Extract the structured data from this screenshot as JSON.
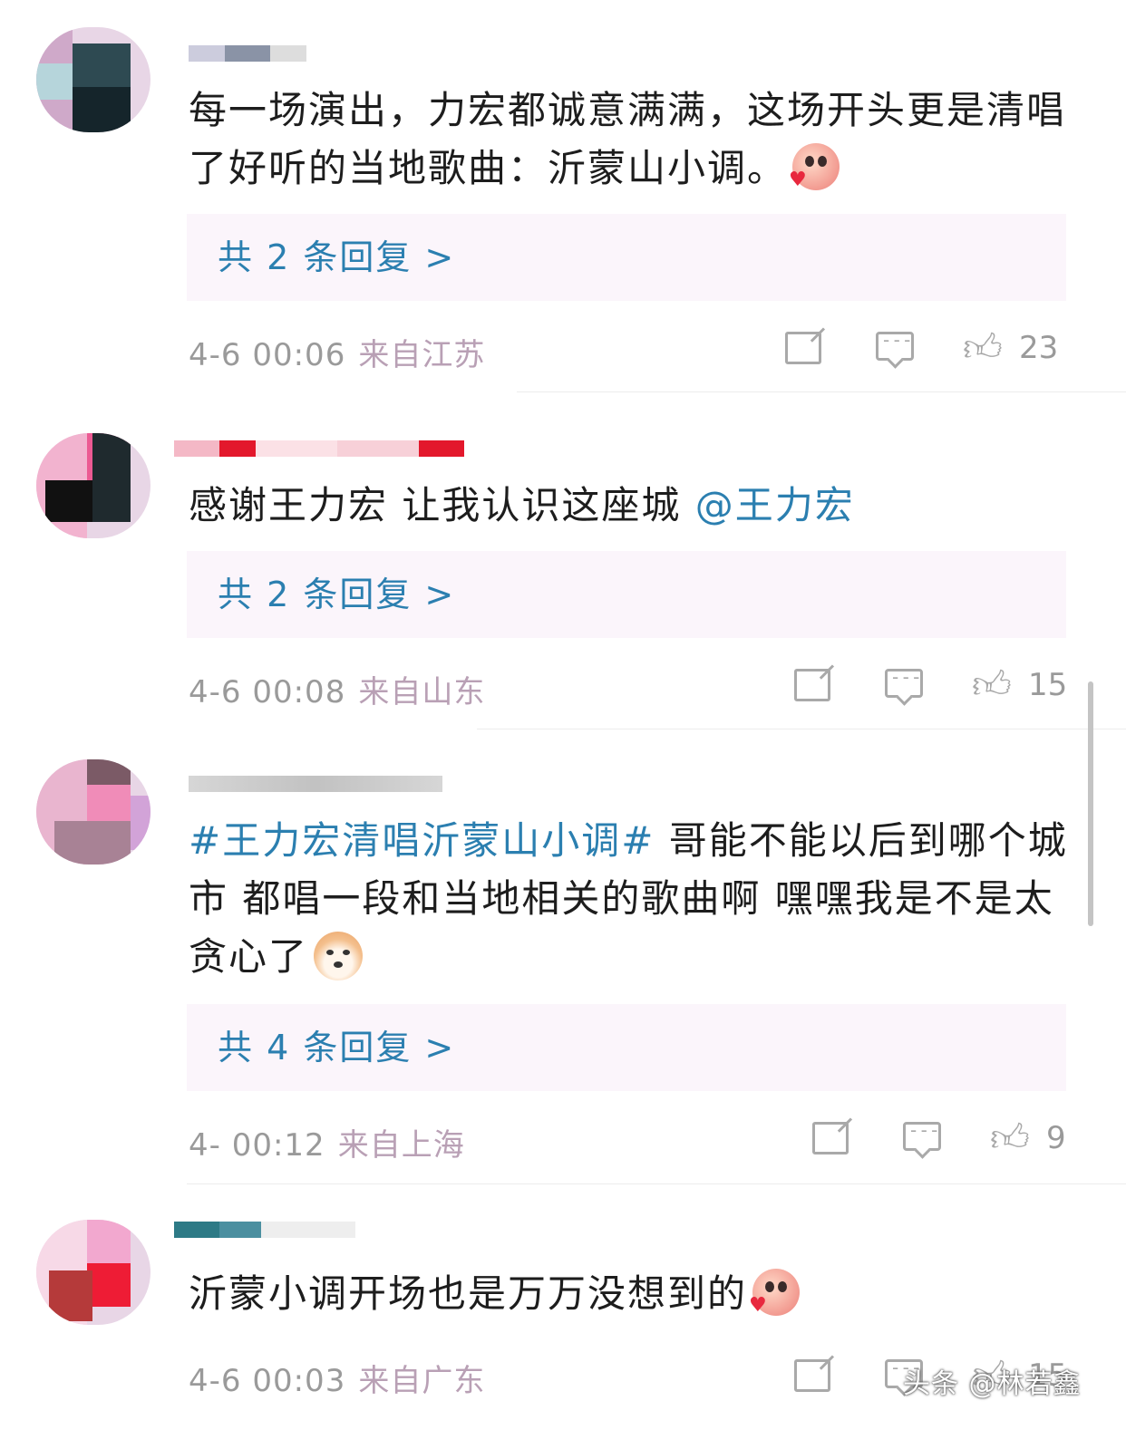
{
  "comments": [
    {
      "text": "每一场演出，力宏都诚意满满，这场开头更是清唱了好听的当地歌曲：沂蒙山小调。",
      "reply_label": "共 2 条回复 >",
      "time": "4-6 00:06",
      "location": "来自江苏",
      "likes": "23"
    },
    {
      "text": "感谢王力宏 让我认识这座城 ",
      "mention": "@王力宏",
      "reply_label": "共 2 条回复 >",
      "time": "4-6 00:08",
      "location": "来自山东",
      "likes": "15"
    },
    {
      "hashtag": "#王力宏清唱沂蒙山小调#",
      "text": " 哥能不能以后到哪个城市 都唱一段和当地相关的歌曲啊 嘿嘿我是不是太贪心了",
      "reply_label": "共 4 条回复 >",
      "time": "4-  00:12",
      "location": "来自上海",
      "likes": "9"
    },
    {
      "text": "沂蒙小调开场也是万万没想到的",
      "time": "4-6 00:03",
      "location": "来自广东",
      "likes": "15"
    }
  ],
  "watermark": "头条 @林若鑫",
  "icons": [
    "share-icon",
    "comment-icon",
    "like-icon",
    "smile-heart-emoji",
    "doge-emoji"
  ],
  "colors": {
    "link": "#2b7fb0",
    "reply_bg": "#fbf5fb",
    "meta": "#9a9a9a"
  }
}
